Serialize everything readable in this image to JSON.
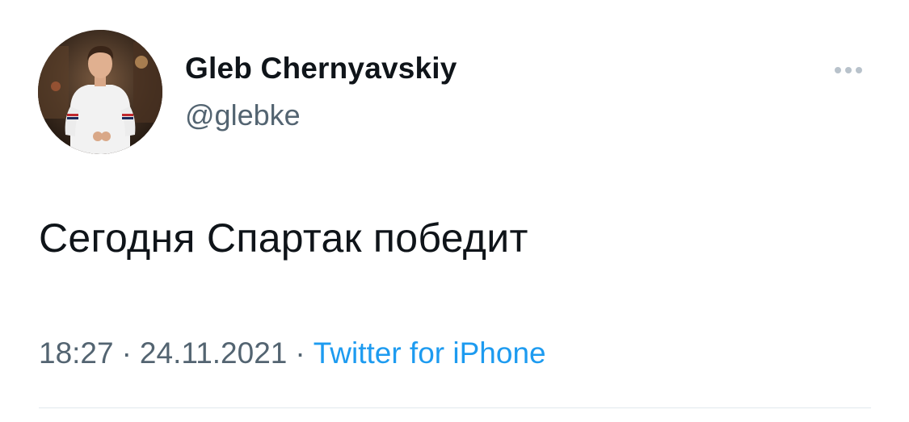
{
  "author": {
    "display_name": "Gleb Chernyavskiy",
    "handle": "@glebke",
    "avatar_icon": "profile-photo"
  },
  "tweet": {
    "text": "Сегодня Спартак победит"
  },
  "meta": {
    "time": "18:27",
    "date": "24.11.2021",
    "separator": "·",
    "source": "Twitter for iPhone"
  },
  "actions": {
    "more_icon": "more-horizontal-icon"
  },
  "colors": {
    "text_primary": "#0f1419",
    "text_secondary": "#536471",
    "link": "#1d9bf0",
    "divider": "#e1e8ed",
    "more_dots": "#b8c2cb"
  }
}
